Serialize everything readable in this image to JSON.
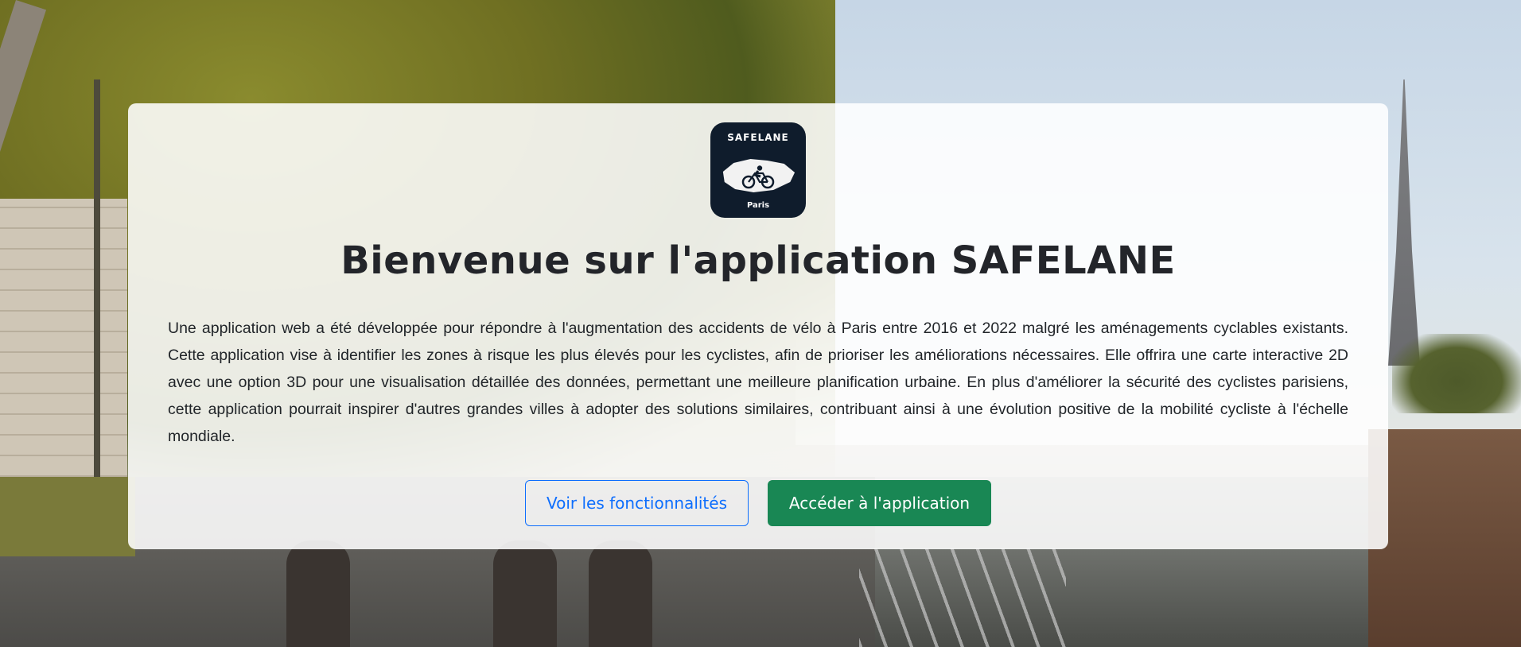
{
  "logo": {
    "top_text": "SAFELANE",
    "bottom_text": "Paris",
    "icon": "cyclist-map-logo"
  },
  "title": "Bienvenue sur l'application SAFELANE",
  "description": "Une application web a été développée pour répondre à l'augmentation des accidents de vélo à Paris entre 2016 et 2022 malgré les aménagements cyclables existants. Cette application vise à identifier les zones à risque les plus élevés pour les cyclistes, afin de prioriser les améliorations nécessaires. Elle offrira une carte interactive 2D avec une option 3D pour une visualisation détaillée des données, permettant une meilleure planification urbaine. En plus d'améliorer la sécurité des cyclistes parisiens, cette application pourrait inspirer d'autres grandes villes à adopter des solutions similaires, contribuant ainsi à une évolution positive de la mobilité cycliste à l'échelle mondiale.",
  "buttons": {
    "features_label": "Voir les fonctionnalités",
    "access_label": "Accéder à l'application"
  },
  "colors": {
    "primary": "#0d6efd",
    "success": "#198754",
    "logo_bg": "#0f1c2c",
    "title": "#23252a"
  }
}
